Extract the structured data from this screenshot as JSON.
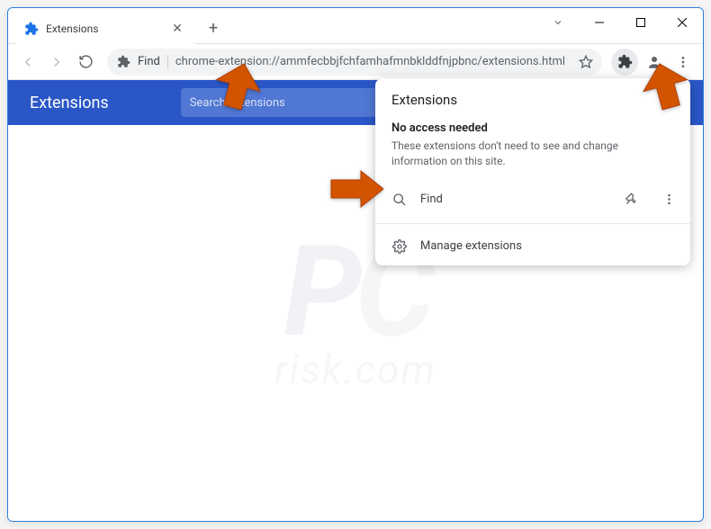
{
  "window": {
    "tab_title": "Extensions"
  },
  "omnibox": {
    "chip": "Find",
    "url": "chrome-extension://ammfecbbjfchfamhafmnbklddfnjpbnc/extensions.html"
  },
  "page": {
    "title": "Extensions",
    "search_placeholder": "Search extensions"
  },
  "popup": {
    "title": "Extensions",
    "section_title": "No access needed",
    "section_desc": "These extensions don't need to see and change information on this site.",
    "items": [
      {
        "name": "Find"
      }
    ],
    "manage_label": "Manage extensions"
  },
  "watermark": {
    "brand_left": "P",
    "brand_right": "C",
    "sub": "risk.com"
  }
}
